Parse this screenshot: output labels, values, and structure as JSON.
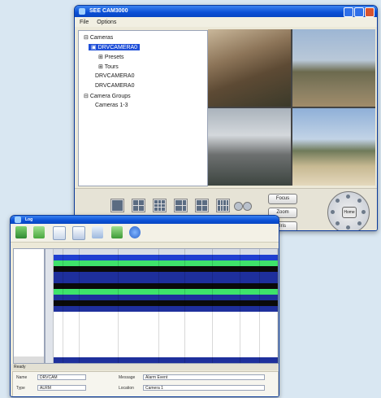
{
  "camera_window": {
    "title": "SEE CAM3000",
    "menu": [
      "File",
      "Options"
    ],
    "tree": [
      {
        "label": "Cameras",
        "indent": 0,
        "selected": false
      },
      {
        "label": "DRVCAMERA0",
        "indent": 1,
        "selected": true
      },
      {
        "label": "Presets",
        "indent": 2,
        "selected": false
      },
      {
        "label": "Tours",
        "indent": 2,
        "selected": false
      },
      {
        "label": "DRVCAMERA0",
        "indent": 1,
        "selected": false
      },
      {
        "label": "DRVCAMERA0",
        "indent": 1,
        "selected": false
      },
      {
        "label": "Camera Groups",
        "indent": 0,
        "selected": false
      },
      {
        "label": "Cameras 1-3",
        "indent": 1,
        "selected": false
      }
    ],
    "buttons": {
      "focus": "Focus",
      "zoom": "Zoom",
      "iris": "Iris",
      "ptz_center": "Home"
    }
  },
  "log_window": {
    "title": "Log",
    "statusbar": "Ready",
    "details": {
      "name_label": "Name",
      "name_value": "DRVCAM",
      "type_label": "Type",
      "type_value": "ALRM",
      "message_label": "Message",
      "message_value": "Alarm Event",
      "location_label": "Location",
      "location_value": "Camera 1"
    }
  },
  "colors": {
    "accent_blue": "#1f3fd0",
    "row_green": "#3ee36b",
    "row_red": "#e8201c",
    "row_black": "#0a0a0a",
    "row_navy": "#1e2f9c"
  }
}
